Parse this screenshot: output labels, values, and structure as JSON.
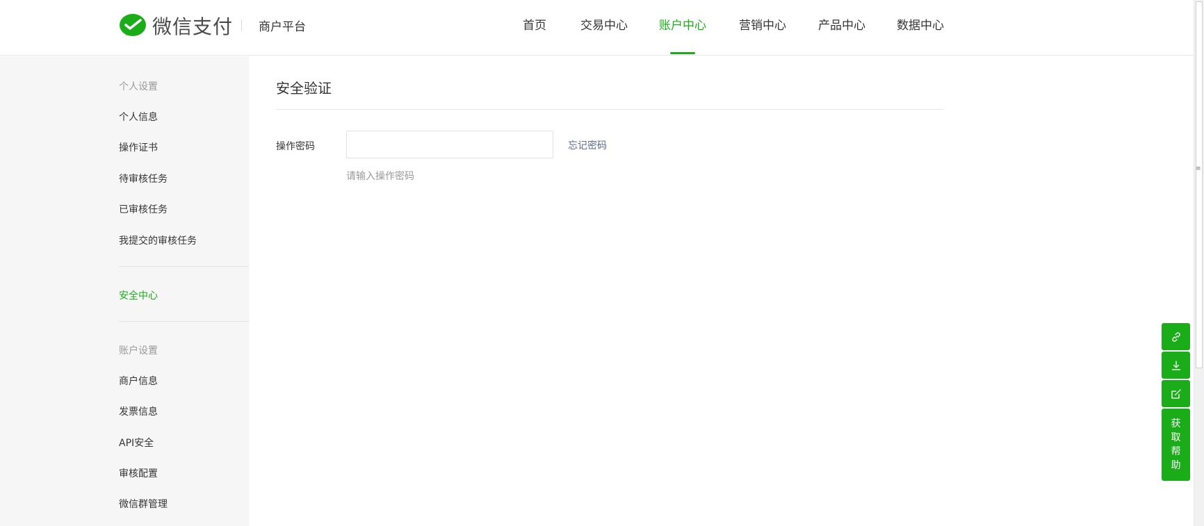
{
  "header": {
    "logo_text": "微信支付",
    "platform": "商户平台",
    "nav": [
      {
        "label": "首页",
        "active": false
      },
      {
        "label": "交易中心",
        "active": false
      },
      {
        "label": "账户中心",
        "active": true
      },
      {
        "label": "营销中心",
        "active": false
      },
      {
        "label": "产品中心",
        "active": false
      },
      {
        "label": "数据中心",
        "active": false
      }
    ]
  },
  "sidebar": {
    "personal_title": "个人设置",
    "personal_items": [
      "个人信息",
      "操作证书",
      "待审核任务",
      "已审核任务",
      "我提交的审核任务"
    ],
    "security": "安全中心",
    "account_title": "账户设置",
    "account_items": [
      "商户信息",
      "发票信息",
      "API安全",
      "审核配置",
      "微信群管理"
    ]
  },
  "main": {
    "title": "安全验证",
    "password_label": "操作密码",
    "password_value": "",
    "forgot_link": "忘记密码",
    "hint": "请输入操作密码"
  },
  "tools": {
    "help_label": "获取帮助"
  },
  "colors": {
    "brand_green": "#1aad19",
    "link_blue": "#576b95",
    "sidebar_bg": "#f6f6f6"
  }
}
